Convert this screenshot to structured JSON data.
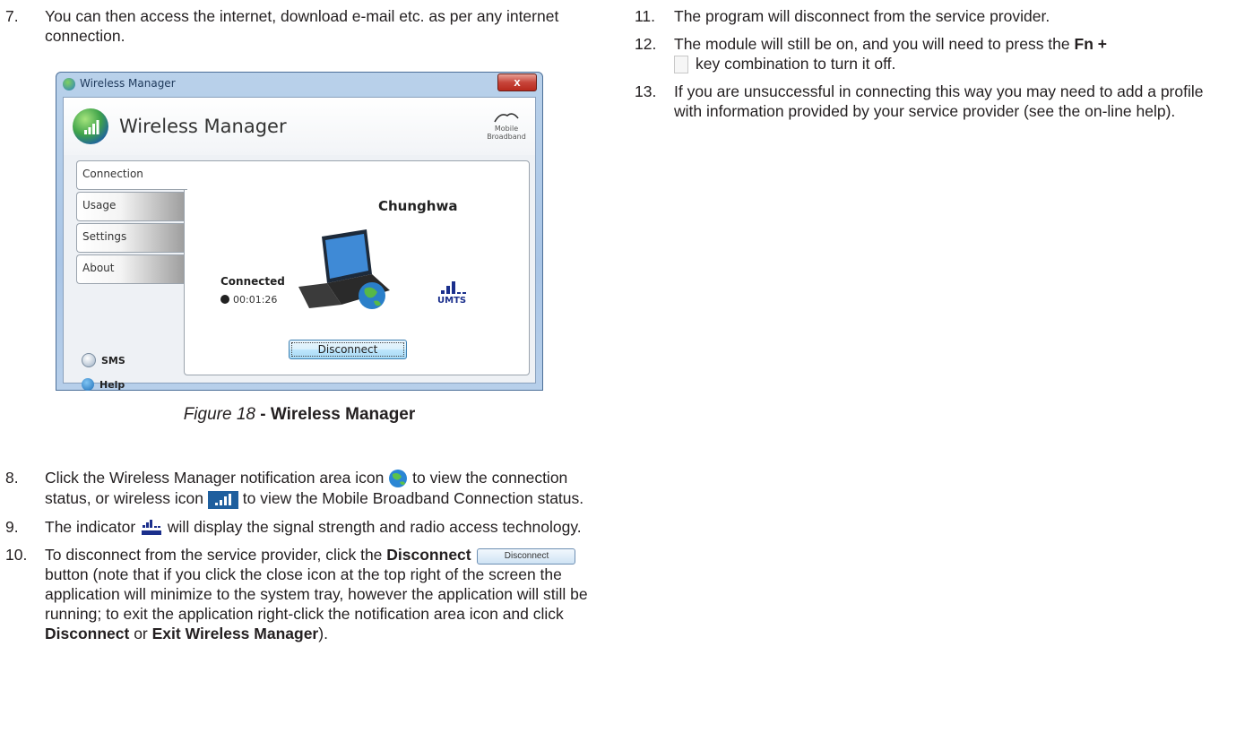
{
  "left_column": {
    "item7": {
      "num": "7.",
      "text": "You can then access the internet, download e-mail etc. as per any internet connection."
    },
    "item8": {
      "num": "8.",
      "text_a": "Click the Wireless Manager notification area icon",
      "text_b": " to view the connection status, or wireless icon",
      "text_c": " to view the Mobile Broadband Connection status."
    },
    "item9": {
      "num": "9.",
      "text_a": "The indicator ",
      "text_b": " will display the signal strength and radio access technology."
    },
    "item10": {
      "num": "10.",
      "text_a": "To disconnect from the service provider, click the ",
      "bold_a": "Disconnect",
      "btn_label": "Disconnect",
      "text_b": " button (note that if you click the close icon at the top right of the screen the application will minimize to the system tray, however the application will still be running; to exit the application right-click the notification area icon and click ",
      "bold_b": "Disconnect",
      "text_c": " or ",
      "bold_c": "Exit Wireless Manager",
      "text_d": ")."
    }
  },
  "right_column": {
    "item11": {
      "num": "11.",
      "text": "The program will disconnect from the service provider."
    },
    "item12": {
      "num": "12.",
      "text_a": "The module will still be on, and you will need to press the ",
      "bold_a": "Fn +",
      "text_b": "key combination to turn it off."
    },
    "item13": {
      "num": "13.",
      "text": "If you are unsuccessful in connecting this way you may need to add a profile with information provided by your service provider (see the on-line help)."
    }
  },
  "caption": {
    "figure": "Figure 18",
    "title": " - Wireless Manager"
  },
  "window": {
    "title": "Wireless Manager",
    "close_label": "x",
    "app_title": "Wireless Manager",
    "brand_line1": "Mobile",
    "brand_line2": "Broadband",
    "tabs": [
      "Connection",
      "Usage",
      "Settings",
      "About"
    ],
    "carrier": "Chunghwa",
    "status": "Connected",
    "timer": "00:01:26",
    "network_type": "UMTS",
    "disconnect_label": "Disconnect",
    "sms_label": "SMS",
    "help_label": "Help"
  }
}
